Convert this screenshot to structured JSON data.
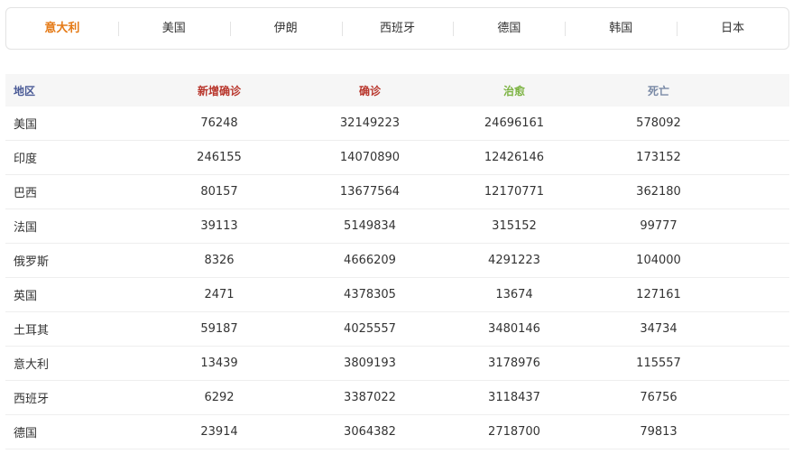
{
  "tabs": [
    {
      "label": "意大利",
      "active": true
    },
    {
      "label": "美国",
      "active": false
    },
    {
      "label": "伊朗",
      "active": false
    },
    {
      "label": "西班牙",
      "active": false
    },
    {
      "label": "德国",
      "active": false
    },
    {
      "label": "韩国",
      "active": false
    },
    {
      "label": "日本",
      "active": false
    }
  ],
  "table": {
    "headers": {
      "region": "地区",
      "new_cases": "新增确诊",
      "confirmed": "确诊",
      "recovered": "治愈",
      "deaths": "死亡"
    },
    "rows": [
      {
        "region": "美国",
        "new_cases": "76248",
        "confirmed": "32149223",
        "recovered": "24696161",
        "deaths": "578092"
      },
      {
        "region": "印度",
        "new_cases": "246155",
        "confirmed": "14070890",
        "recovered": "12426146",
        "deaths": "173152"
      },
      {
        "region": "巴西",
        "new_cases": "80157",
        "confirmed": "13677564",
        "recovered": "12170771",
        "deaths": "362180"
      },
      {
        "region": "法国",
        "new_cases": "39113",
        "confirmed": "5149834",
        "recovered": "315152",
        "deaths": "99777"
      },
      {
        "region": "俄罗斯",
        "new_cases": "8326",
        "confirmed": "4666209",
        "recovered": "4291223",
        "deaths": "104000"
      },
      {
        "region": "英国",
        "new_cases": "2471",
        "confirmed": "4378305",
        "recovered": "13674",
        "deaths": "127161"
      },
      {
        "region": "土耳其",
        "new_cases": "59187",
        "confirmed": "4025557",
        "recovered": "3480146",
        "deaths": "34734"
      },
      {
        "region": "意大利",
        "new_cases": "13439",
        "confirmed": "3809193",
        "recovered": "3178976",
        "deaths": "115557"
      },
      {
        "region": "西班牙",
        "new_cases": "6292",
        "confirmed": "3387022",
        "recovered": "3118437",
        "deaths": "76756"
      },
      {
        "region": "德国",
        "new_cases": "23914",
        "confirmed": "3064382",
        "recovered": "2718700",
        "deaths": "79813"
      }
    ]
  }
}
